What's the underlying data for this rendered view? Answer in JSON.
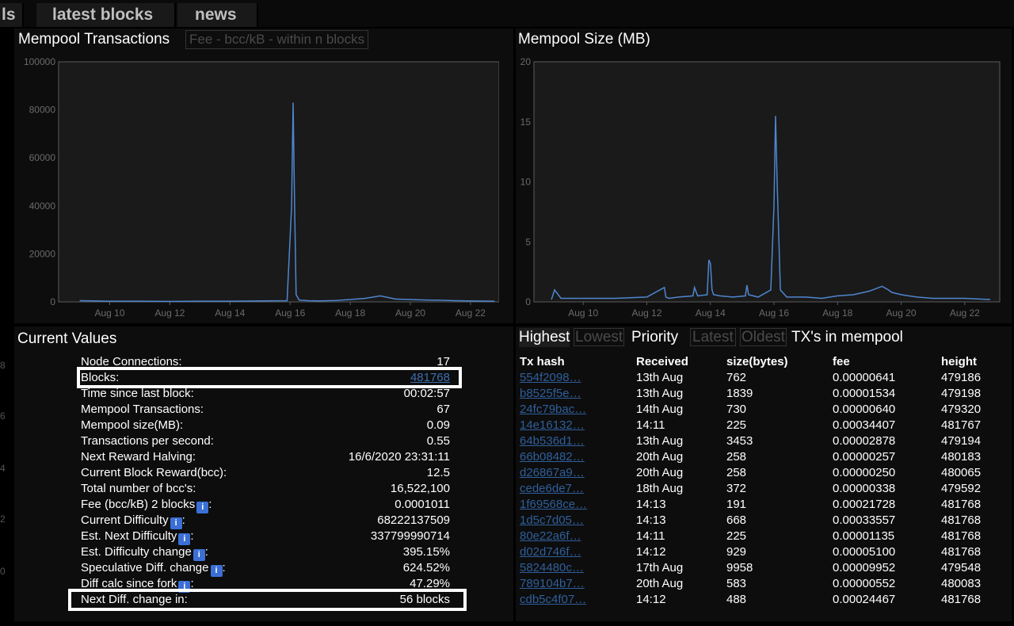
{
  "nav": {
    "tabs": [
      {
        "label": "ls"
      },
      {
        "label": "latest blocks"
      },
      {
        "label": "news"
      }
    ]
  },
  "mempool_tx_panel": {
    "title": "Mempool Transactions",
    "subtab": "Fee - bcc/kB - within n blocks"
  },
  "mempool_size_panel": {
    "title": "Mempool Size (MB)"
  },
  "chart_data": [
    {
      "type": "line",
      "ylim": [
        0,
        100000
      ],
      "y_ticks": [
        "0",
        "20000",
        "40000",
        "60000",
        "80000",
        "100000"
      ],
      "x_ticks": [
        "Aug 10",
        "Aug 12",
        "Aug 14",
        "Aug 16",
        "Aug 18",
        "Aug 20",
        "Aug 22"
      ],
      "grid": false,
      "series": [
        {
          "x": [
            9,
            10,
            11,
            12,
            13,
            14,
            15,
            15.9,
            16.05,
            16.1,
            16.15,
            16.2,
            16.3,
            16.6,
            17,
            17.5,
            18,
            18.5,
            19,
            19.5,
            20,
            20.5,
            21,
            21.5,
            22,
            22.8
          ],
          "values": [
            500,
            300,
            300,
            200,
            300,
            300,
            400,
            500,
            40000,
            83000,
            40000,
            3000,
            800,
            500,
            400,
            600,
            1000,
            1500,
            2500,
            1200,
            1000,
            800,
            700,
            500,
            400,
            300
          ]
        }
      ]
    },
    {
      "type": "line",
      "ylim": [
        0,
        20
      ],
      "y_ticks": [
        "0",
        "5",
        "10",
        "15",
        "20"
      ],
      "x_ticks": [
        "Aug 10",
        "Aug 12",
        "Aug 14",
        "Aug 16",
        "Aug 18",
        "Aug 20",
        "Aug 22"
      ],
      "grid": false,
      "series": [
        {
          "x": [
            9,
            9.1,
            9.3,
            10,
            11,
            12,
            12.55,
            12.6,
            12.7,
            13,
            13.45,
            13.5,
            13.6,
            13.9,
            13.95,
            14,
            14.05,
            14.1,
            14.3,
            14.7,
            15.1,
            15.15,
            15.2,
            15.5,
            15.9,
            16.0,
            16.05,
            16.1,
            16.2,
            16.4,
            17,
            17.5,
            18,
            18.5,
            19,
            19.4,
            19.6,
            19.7,
            20,
            20.5,
            21,
            21.5,
            22,
            22.8
          ],
          "values": [
            0.2,
            1.0,
            0.3,
            0.3,
            0.3,
            0.4,
            1.2,
            0.4,
            0.3,
            0.4,
            0.5,
            1.2,
            0.5,
            0.6,
            3.5,
            3.2,
            1.0,
            0.6,
            0.5,
            0.4,
            0.5,
            1.4,
            0.6,
            0.4,
            1.0,
            8.0,
            15.5,
            10.0,
            1.0,
            0.4,
            0.4,
            0.3,
            0.5,
            0.6,
            0.9,
            1.3,
            1.0,
            0.8,
            0.6,
            0.4,
            0.3,
            0.3,
            0.3,
            0.2
          ]
        }
      ]
    }
  ],
  "current_values": {
    "title": "Current Values",
    "rows": [
      {
        "label": "Node Connections:",
        "value": "17"
      },
      {
        "label": "Blocks:",
        "value": "481768"
      },
      {
        "label": "Time since last block:",
        "value": "00:02:57"
      },
      {
        "label": "Mempool Transactions:",
        "value": "67"
      },
      {
        "label": "Mempool size(MB):",
        "value": "0.09"
      },
      {
        "label": "Transactions per second:",
        "value": "0.55"
      },
      {
        "label": "Next Reward Halving:",
        "value": "16/6/2020 23:31:11"
      },
      {
        "label": "Current Block Reward(bcc):",
        "value": "12.5"
      },
      {
        "label": "Total number of bcc's:",
        "value": "16,522,100"
      },
      {
        "label": "Fee (bcc/kB) 2 blocks",
        "value": "0.0001011"
      },
      {
        "label": "Current Difficulty",
        "value": "68222137509"
      },
      {
        "label": "Est. Next Difficulty",
        "value": "337799990714"
      },
      {
        "label": "Est. Difficulty change",
        "value": "395.15%"
      },
      {
        "label": "Speculative Diff. change",
        "value": "624.52%"
      },
      {
        "label": "Diff calc since fork",
        "value": "47.29%"
      },
      {
        "label": "Next Diff. change in:",
        "value": "56 blocks"
      }
    ],
    "info_glyph": "i"
  },
  "left_axis_fragments": [
    "8",
    "6",
    "4",
    "2",
    "0"
  ],
  "mempool_list": {
    "tabs": {
      "highest": "Highest",
      "lowest": "Lowest",
      "priority": "Priority",
      "latest": "Latest",
      "oldest": "Oldest",
      "title": "TX's in mempool"
    },
    "headers": {
      "hash": "Tx hash",
      "received": "Received",
      "size": "size(bytes)",
      "fee": "fee",
      "height": "height"
    },
    "rows": [
      {
        "hash": "554f2098…",
        "received": "13th Aug",
        "size": "762",
        "fee": "0.00000641",
        "height": "479186"
      },
      {
        "hash": "b8525f5e…",
        "received": "13th Aug",
        "size": "1839",
        "fee": "0.00001534",
        "height": "479198"
      },
      {
        "hash": "24fc79bac…",
        "received": "14th Aug",
        "size": "730",
        "fee": "0.00000640",
        "height": "479320"
      },
      {
        "hash": "14e16132…",
        "received": "14:11",
        "size": "225",
        "fee": "0.00034407",
        "height": "481767"
      },
      {
        "hash": "64b536d1…",
        "received": "13th Aug",
        "size": "3453",
        "fee": "0.00002878",
        "height": "479194"
      },
      {
        "hash": "66b08482…",
        "received": "20th Aug",
        "size": "258",
        "fee": "0.00000257",
        "height": "480183"
      },
      {
        "hash": "d26867a9…",
        "received": "20th Aug",
        "size": "258",
        "fee": "0.00000250",
        "height": "480065"
      },
      {
        "hash": "cede6de7…",
        "received": "18th Aug",
        "size": "372",
        "fee": "0.00000338",
        "height": "479592"
      },
      {
        "hash": "1f69568ce…",
        "received": "14:13",
        "size": "191",
        "fee": "0.00021728",
        "height": "481768"
      },
      {
        "hash": "1d5c7d05…",
        "received": "14:13",
        "size": "668",
        "fee": "0.00033557",
        "height": "481768"
      },
      {
        "hash": "80e22a6f…",
        "received": "14:11",
        "size": "225",
        "fee": "0.00001135",
        "height": "481768"
      },
      {
        "hash": "d02d746f…",
        "received": "14:12",
        "size": "929",
        "fee": "0.00005100",
        "height": "481768"
      },
      {
        "hash": "5824480c…",
        "received": "17th Aug",
        "size": "9958",
        "fee": "0.00009952",
        "height": "479548"
      },
      {
        "hash": "789104b7…",
        "received": "20th Aug",
        "size": "583",
        "fee": "0.00000552",
        "height": "480083"
      },
      {
        "hash": "cdb5c4f07…",
        "received": "14:12",
        "size": "488",
        "fee": "0.00024467",
        "height": "481768"
      }
    ]
  },
  "colors": {
    "line": "#4f86cf",
    "link": "#2f5f9c",
    "info_icon": "#3b6fd6",
    "background": "#000000",
    "panel": "#0d0d0d"
  }
}
